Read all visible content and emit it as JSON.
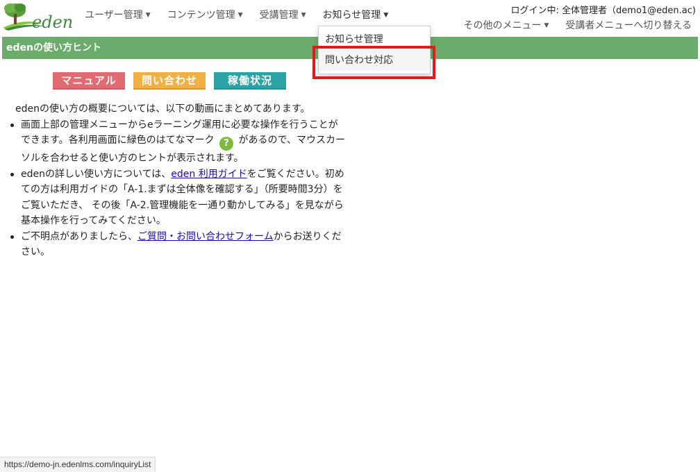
{
  "header": {
    "logo_text": "eden",
    "nav": [
      {
        "label": "ユーザー管理"
      },
      {
        "label": "コンテンツ管理"
      },
      {
        "label": "受講管理"
      },
      {
        "label": "お知らせ管理"
      }
    ],
    "login_info": "ログイン中: 全体管理者（demo1@eden.ac)",
    "right_nav": {
      "other_menu": "その他のメニュー",
      "switch_menu": "受講者メニューへ切り替える"
    }
  },
  "dropdown": {
    "items": [
      {
        "label": "お知らせ管理"
      },
      {
        "label": "問い合わせ対応"
      }
    ]
  },
  "hint_bar": {
    "title": "edenの使い方ヒント"
  },
  "buttons": {
    "manual": "マニュアル",
    "contact": "問い合わせ",
    "status": "稼働状況"
  },
  "content": {
    "intro": "edenの使い方の概要については、以下の動画にまとめてあります。",
    "b1_text1": "画面上部の管理メニューからeラーニング運用に必要な操作を行うことができます。各利用画面に緑色のはてなマーク",
    "qmark": "?",
    "b1_text2": "があるので、マウスカーソルを合わせると使い方のヒントが表示されます。",
    "b2_text1": "edenの詳しい使い方については、",
    "b2_link": "eden 利用ガイド",
    "b2_text2": "をご覧ください。初めての方は利用ガイドの「A-1.まずは全体像を確認する」（所要時間3分）をご覧いただき、 その後「A-2.管理機能を一通り動かしてみる」を見ながら基本操作を行ってみてください。",
    "b3_text1": "ご不明点がありましたら、",
    "b3_link": "ご質問・お問い合わせフォーム",
    "b3_text2": "からお送りください。"
  },
  "statusbar": {
    "url": "https://demo-jn.edenlms.com/inquiryList"
  }
}
